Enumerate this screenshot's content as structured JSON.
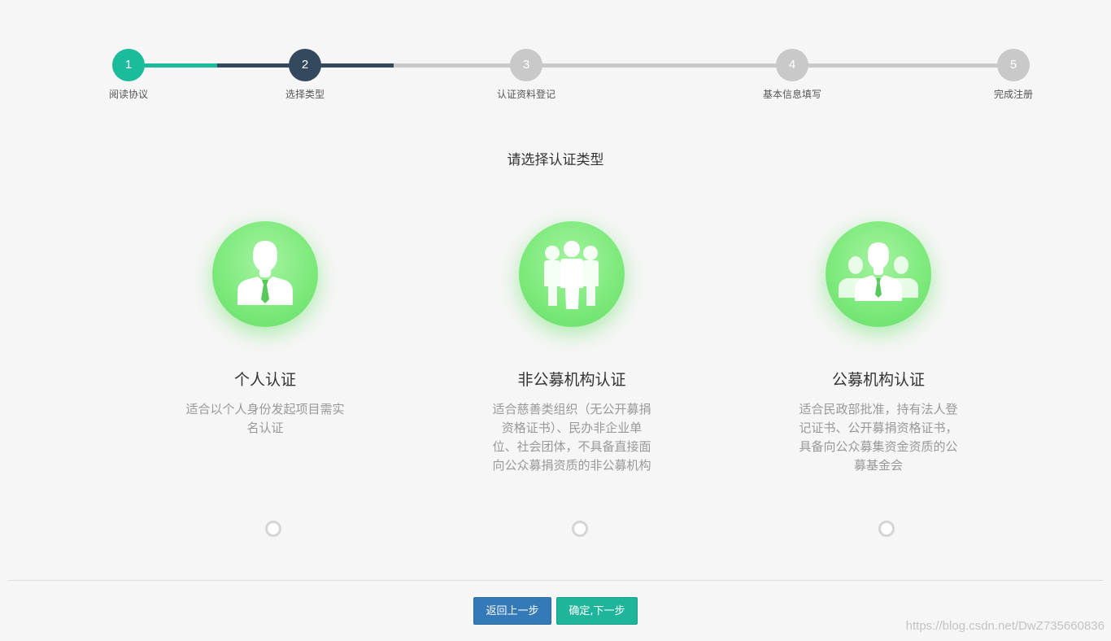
{
  "colors": {
    "step_done": "#1abc9c",
    "step_current": "#34495e",
    "step_pending": "#c9c9c9",
    "avatar_green": "#7fea7d",
    "btn_back": "#337ab7",
    "btn_next": "#1fb59b"
  },
  "steps": [
    {
      "number": "1",
      "label": "阅读协议",
      "state": "done"
    },
    {
      "number": "2",
      "label": "选择类型",
      "state": "current"
    },
    {
      "number": "3",
      "label": "认证资料登记",
      "state": "pending"
    },
    {
      "number": "4",
      "label": "基本信息填写",
      "state": "pending"
    },
    {
      "number": "5",
      "label": "完成注册",
      "state": "pending"
    }
  ],
  "prompt": "请选择认证类型",
  "options": [
    {
      "icon": "person-icon",
      "title": "个人认证",
      "description": "适合以个人身份发起项目需实名认证",
      "selected": false
    },
    {
      "icon": "group-icon",
      "title": "非公募机构认证",
      "description": "适合慈善类组织（无公开募捐资格证书）、民办非企业单位、社会团体，不具备直接面向公众募捐资质的非公募机构",
      "selected": false
    },
    {
      "icon": "team-leader-icon",
      "title": "公募机构认证",
      "description": "适合民政部批准，持有法人登记证书、公开募捐资格证书，具备向公众募集资金资质的公募基金会",
      "selected": false
    }
  ],
  "buttons": {
    "back": "返回上一步",
    "next": "确定,下一步"
  },
  "watermark": "https://blog.csdn.net/DwZ735660836"
}
